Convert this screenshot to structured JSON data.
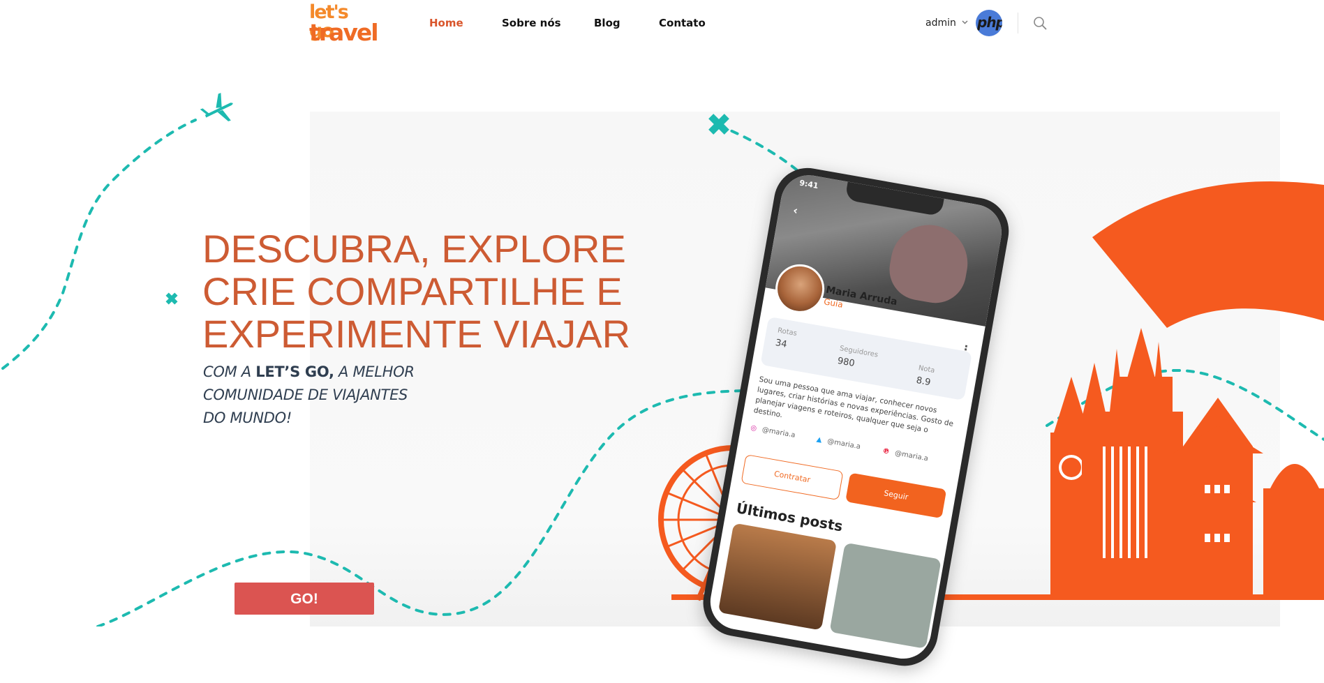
{
  "brand": {
    "logo_line1": "let's go",
    "logo_line2": "travel"
  },
  "nav": {
    "home": "Home",
    "about": "Sobre nós",
    "blog": "Blog",
    "contact": "Contato"
  },
  "user": {
    "name": "admin",
    "avatar_text": "php"
  },
  "hero": {
    "headline_1": "DESCUBRA, EXPLORE",
    "headline_2": "CRIE COMPARTILHE E",
    "headline_3": "EXPERIMENTE VIAJAR",
    "tagline_prefix": "COM A",
    "tagline_brand": "LET’S GO,",
    "tagline_suffix": "A MELHOR",
    "tagline_2": "COMUNIDADE DE VIAJANTES",
    "tagline_3": "DO MUNDO!",
    "cta": "GO!"
  },
  "phone": {
    "time": "9:41",
    "name": "Maria Arruda",
    "role": "Guia",
    "stats": [
      {
        "label": "Rotas",
        "value": "34"
      },
      {
        "label": "Seguidores",
        "value": "980"
      },
      {
        "label": "Nota",
        "value": "8.9"
      }
    ],
    "bio": "Sou uma pessoa que ama viajar, conhecer novos lugares, criar histórias e novas experiências. Gosto de planejar viagens e roteiros, qualquer que seja o destino.",
    "social": [
      "@maria.a",
      "@maria.a",
      "@maria.a"
    ],
    "hire": "Contratar",
    "follow": "Seguir",
    "posts_title": "Últimos posts"
  },
  "colors": {
    "accent": "#d9552b",
    "orange": "#f2631f",
    "teal": "#1dbab0",
    "cta": "#db5451",
    "headline": "#cd5b33"
  },
  "icons": [
    "chevron-down-icon",
    "search-icon",
    "airplane-icon",
    "cross-icon",
    "instagram-icon",
    "twitter-icon",
    "pinterest-icon"
  ]
}
